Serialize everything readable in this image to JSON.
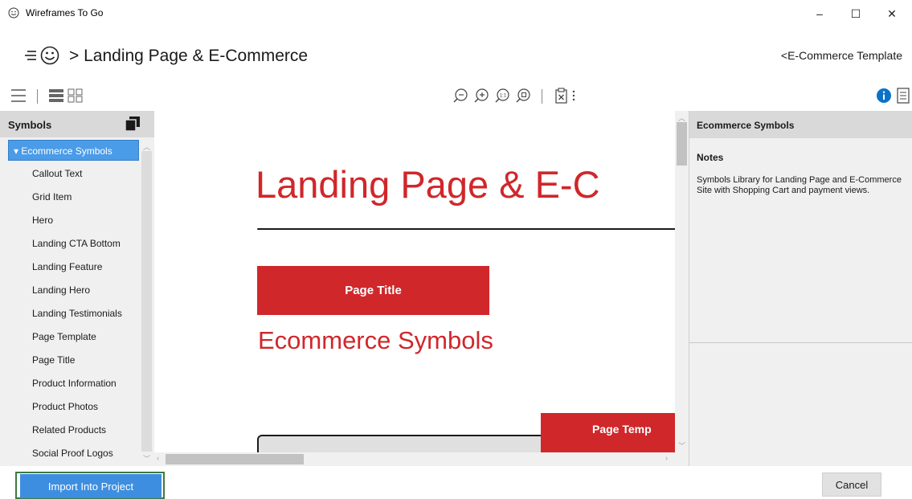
{
  "window": {
    "title": "Wireframes To Go",
    "controls": {
      "minimize": "–",
      "maximize": "☐",
      "close": "✕"
    }
  },
  "header": {
    "breadcrumb": "> Landing Page & E-Commerce",
    "template_link": "<E-Commerce Template"
  },
  "toolbar": {
    "icons": [
      "menu-icon",
      "list-view-icon",
      "grid-view-icon",
      "zoom-out-icon",
      "zoom-in-icon",
      "zoom-actual-icon",
      "zoom-fit-icon",
      "export-icon",
      "more-icon",
      "info-icon",
      "notes-icon"
    ]
  },
  "left_panel": {
    "title": "Symbols",
    "selected_item": "▾ Ecommerce Symbols",
    "items": [
      "Callout Text",
      "Grid Item",
      "Hero",
      "Landing CTA Bottom",
      "Landing Feature",
      "Landing Hero",
      "Landing Testimonials",
      "Page Template",
      "Page Title",
      "Product Information",
      "Product Photos",
      "Related Products",
      "Social Proof Logos"
    ]
  },
  "canvas": {
    "big_title": "Landing Page & E-C",
    "page_title_button": "Page Title",
    "sub_title": "Ecommerce Symbols",
    "page_template_button": "Page Temp"
  },
  "right_panel": {
    "title": "Ecommerce Symbols",
    "notes_label": "Notes",
    "notes_text": "Symbols Library for Landing Page and E-Commerce Site with Shopping Cart and payment views."
  },
  "footer": {
    "import_label": "Import Into Project",
    "cancel_label": "Cancel"
  },
  "colors": {
    "accent_red": "#d0272b",
    "selection_blue": "#4a9be8",
    "primary_button": "#3d8ee0",
    "info_blue": "#0a73c7"
  }
}
